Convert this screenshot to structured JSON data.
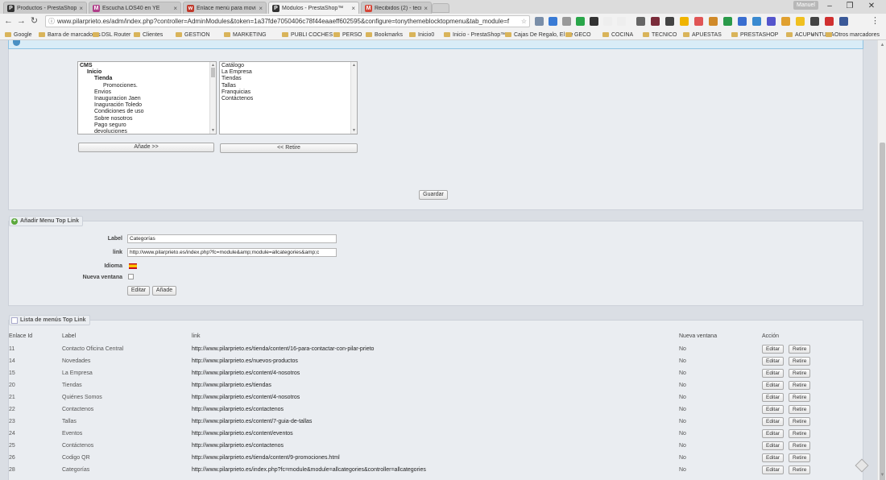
{
  "browser": {
    "tabs": [
      {
        "title": "Productos - PrestaShop™",
        "favicon": "P",
        "color": "#333333"
      },
      {
        "title": "Escucha LOS40 en YE",
        "favicon": "M",
        "color": "#b0408a"
      },
      {
        "title": "Enlace menú para movil",
        "favicon": "w",
        "color": "#c0392b"
      },
      {
        "title": "Módulos - PrestaShop™",
        "favicon": "P",
        "color": "#333333"
      },
      {
        "title": "Recibidos (2) - tecnicope",
        "favicon": "M",
        "color": "#d44638"
      }
    ],
    "user_label": "Manuel",
    "url": "www.pilarprieto.es/adm/index.php?controller=AdminModules&token=1a37fde7050406c78f44eaaeff602595&configure=tonythemeblocktopmenu&tab_module=f",
    "bookmarks": [
      "Google",
      "Barra de marcadores",
      "DSL Router",
      "Clientes",
      "GESTION",
      "MARKETING",
      "PUBLI COCHES",
      "PERSO",
      "Bookmarks",
      "Inicio0",
      "Inicio - PrestaShop™",
      "Cajas De Regalo, El Pe",
      "GECO",
      "COCINA",
      "TECNICO",
      "APUESTAS",
      "PRESTASHOP",
      "ACUPUNTURA"
    ],
    "other_bookmarks": "Otros marcadores",
    "overflow": "»"
  },
  "menu_config": {
    "available_items": [
      {
        "label": "CMS",
        "bold": true,
        "indent": 0
      },
      {
        "label": "Inicio",
        "bold": true,
        "indent": 1
      },
      {
        "label": "Tienda",
        "bold": true,
        "indent": 2
      },
      {
        "label": "Promociones.",
        "bold": false,
        "indent": 3
      },
      {
        "label": "Envios",
        "bold": false,
        "indent": 2
      },
      {
        "label": "Inauguracion Jaen",
        "bold": false,
        "indent": 2
      },
      {
        "label": "Inaguración Toledo",
        "bold": false,
        "indent": 2
      },
      {
        "label": "Condiciones de uso",
        "bold": false,
        "indent": 2
      },
      {
        "label": "Sobre nosotros",
        "bold": false,
        "indent": 2
      },
      {
        "label": "Pago seguro",
        "bold": false,
        "indent": 2
      },
      {
        "label": "devoluciones",
        "bold": false,
        "indent": 2
      }
    ],
    "selected_items": [
      "Catálogo",
      "La Empresa",
      "Tiendas",
      "Tallas",
      "Franquicias",
      "Contáctenos"
    ],
    "add_button": "Añade >>",
    "remove_button": "<< Retire",
    "save_button": "Guardar"
  },
  "add_link": {
    "legend": "Añadir Menu Top Link",
    "label_label": "Label",
    "label_value": "Categorías",
    "link_label": "link",
    "link_value": "http://www.pilarprieto.es/index.php?fc=module&amp;module=allcategories&amp;c",
    "language_label": "Idioma",
    "new_window_label": "Nueva ventana",
    "edit_button": "Editar",
    "add_button": "Añade"
  },
  "links_list": {
    "legend": "Lista de menús Top Link",
    "columns": [
      "Enlace Id",
      "Label",
      "link",
      "Nueva ventana",
      "Acción"
    ],
    "edit_label": "Editar",
    "remove_label": "Retire",
    "rows": [
      {
        "id": "11",
        "label": "Contacto Oficina Central",
        "link": "http://www.pilarprieto.es/tienda/content/16-para-contactar-con-pilar-prieto",
        "new_window": "No"
      },
      {
        "id": "14",
        "label": "Novedades",
        "link": "http://www.pilarprieto.es/nuevos-productos",
        "new_window": "No"
      },
      {
        "id": "15",
        "label": "La Empresa",
        "link": "http://www.pilarprieto.es/content/4-nosotros",
        "new_window": "No"
      },
      {
        "id": "20",
        "label": "Tiendas",
        "link": "http://www.pilarprieto.es/tiendas",
        "new_window": "No"
      },
      {
        "id": "21",
        "label": "Quiénes Somos",
        "link": "http://www.pilarprieto.es/content/4-nosotros",
        "new_window": "No"
      },
      {
        "id": "22",
        "label": "Contactenos",
        "link": "http://www.pilarprieto.es/contactenos",
        "new_window": "No"
      },
      {
        "id": "23",
        "label": "Tallas",
        "link": "http://www.pilarprieto.es/content/7-guia-de-tallas",
        "new_window": "No"
      },
      {
        "id": "24",
        "label": "Eventos",
        "link": "http://www.pilarprieto.es/content/eventos",
        "new_window": "No"
      },
      {
        "id": "25",
        "label": "Contáctenos",
        "link": "http://www.pilarprieto.es/contactenos",
        "new_window": "No"
      },
      {
        "id": "26",
        "label": "Codigo QR",
        "link": "http://www.pilarprieto.es/tienda/content/9-promociones.html",
        "new_window": "No"
      },
      {
        "id": "28",
        "label": "Categorías",
        "link": "http://www.pilarprieto.es/index.php?fc=module&module=allcategories&controller=allcategories",
        "new_window": "No"
      }
    ]
  }
}
